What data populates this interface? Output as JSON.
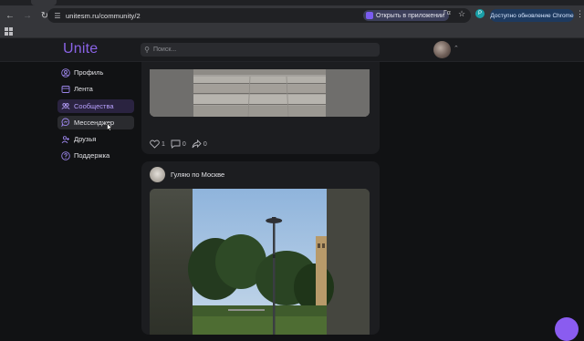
{
  "browser": {
    "url": "unitesm.ru/community/2",
    "open_in_app": "Открыть в приложении",
    "update_button": "Доступно обновление Chrome",
    "translate_icon": "translate-icon",
    "extension_letter": "P"
  },
  "header": {
    "logo": "Unite",
    "search_placeholder": "Поиск..."
  },
  "sidebar": {
    "items": [
      {
        "label": "Профиль",
        "icon": "profile-icon"
      },
      {
        "label": "Лента",
        "icon": "feed-icon"
      },
      {
        "label": "Сообщества",
        "icon": "communities-icon",
        "active": true
      },
      {
        "label": "Мессенджер",
        "icon": "messenger-icon",
        "hover": true
      },
      {
        "label": "Друзья",
        "icon": "friends-icon"
      },
      {
        "label": "Поддержка",
        "icon": "support-icon"
      }
    ]
  },
  "posts": [
    {
      "likes": "1",
      "comments": "0",
      "reposts": "0"
    },
    {
      "title": "Гуляю по Москве"
    }
  ],
  "colors": {
    "accent": "#8a63e6",
    "active_bg": "#2a2340",
    "page_bg": "#111214",
    "card_bg": "#1c1d20"
  }
}
